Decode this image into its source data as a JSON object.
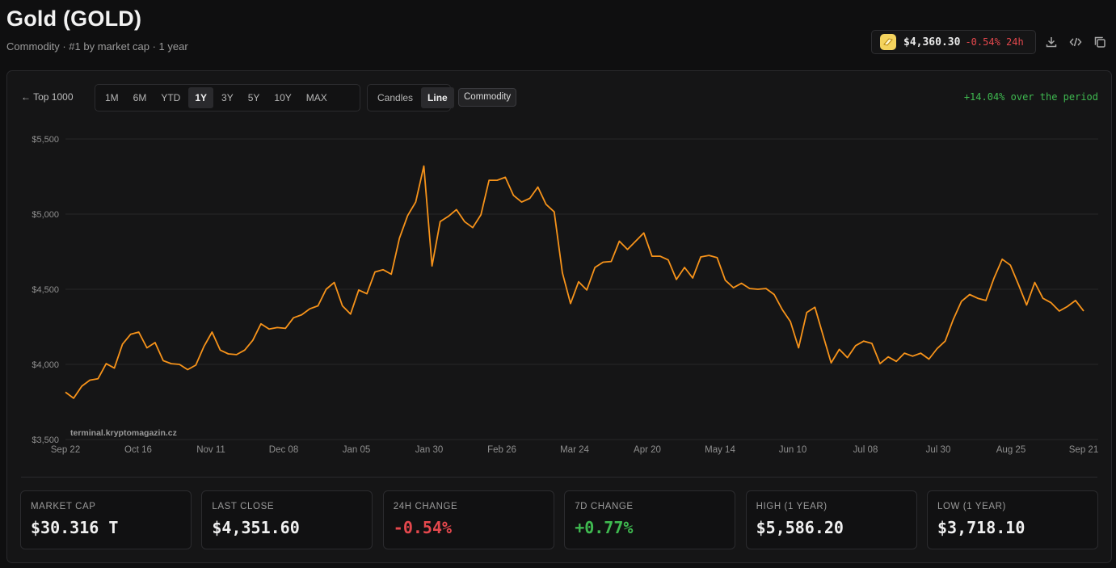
{
  "header": {
    "title": "Gold (GOLD)",
    "subtitle": "Commodity · #1 by market cap · 1 year"
  },
  "price_pill": {
    "price": "$4,360.30",
    "change": "-0.54% 24h",
    "change_color": "#e5484d"
  },
  "header_icons": [
    "download-icon",
    "code-icon",
    "copy-icon"
  ],
  "toolbar": {
    "back_label": "← Top 1000",
    "ranges": [
      {
        "label": "1M",
        "active": false
      },
      {
        "label": "6M",
        "active": false
      },
      {
        "label": "YTD",
        "active": false
      },
      {
        "label": "1Y",
        "active": true
      },
      {
        "label": "3Y",
        "active": false
      },
      {
        "label": "5Y",
        "active": false
      },
      {
        "label": "10Y",
        "active": false
      },
      {
        "label": "MAX",
        "active": false
      }
    ],
    "chart_types": [
      {
        "label": "Candles",
        "active": false
      },
      {
        "label": "Line",
        "active": true
      }
    ],
    "tag_label": "Commodity",
    "period_change": "+14.04% over the period",
    "period_change_color": "#3fb950"
  },
  "chart_data": {
    "type": "line",
    "title": "",
    "xlabel": "",
    "ylabel": "",
    "ylim": [
      3500,
      5500
    ],
    "y_ticks": [
      "$5,500",
      "$5,000",
      "$4,500",
      "$4,000",
      "$3,500"
    ],
    "y_tick_values": [
      5500,
      5000,
      4500,
      4000,
      3500
    ],
    "x_ticks": [
      "Sep 22",
      "Oct 16",
      "Nov 11",
      "Dec 08",
      "Jan 05",
      "Jan 30",
      "Feb 26",
      "Mar 24",
      "Apr 20",
      "May 14",
      "Jun 10",
      "Jul 08",
      "Jul 30",
      "Aug 25",
      "Sep 21"
    ],
    "grid": true,
    "line_color": "#f7931a",
    "watermark": "terminal.kryptomagazin.cz",
    "series": [
      {
        "values": [
          3815,
          3775,
          3855,
          3895,
          3905,
          4005,
          3975,
          4135,
          4200,
          4215,
          4110,
          4145,
          4025,
          4005,
          4000,
          3965,
          3995,
          4120,
          4215,
          4095,
          4070,
          4065,
          4095,
          4160,
          4270,
          4235,
          4245,
          4240,
          4310,
          4330,
          4370,
          4390,
          4500,
          4545,
          4390,
          4335,
          4495,
          4470,
          4615,
          4630,
          4600,
          4840,
          4990,
          5080,
          5320,
          4655,
          4950,
          4985,
          5030,
          4950,
          4910,
          4995,
          5225,
          5225,
          5245,
          5125,
          5080,
          5105,
          5180,
          5065,
          5015,
          4610,
          4405,
          4550,
          4495,
          4645,
          4680,
          4685,
          4820,
          4765,
          4820,
          4875,
          4720,
          4720,
          4695,
          4565,
          4645,
          4575,
          4715,
          4725,
          4710,
          4560,
          4510,
          4540,
          4505,
          4500,
          4505,
          4465,
          4365,
          4285,
          4110,
          4345,
          4380,
          4195,
          4010,
          4100,
          4045,
          4125,
          4155,
          4140,
          4005,
          4050,
          4020,
          4075,
          4055,
          4075,
          4035,
          4105,
          4155,
          4300,
          4420,
          4465,
          4440,
          4425,
          4575,
          4700,
          4660,
          4530,
          4395,
          4545,
          4440,
          4410,
          4355,
          4385,
          4425,
          4355
        ]
      }
    ]
  },
  "stats": [
    {
      "label": "MARKET CAP",
      "value": "$30.316 T",
      "tone": "neutral"
    },
    {
      "label": "LAST CLOSE",
      "value": "$4,351.60",
      "tone": "neutral"
    },
    {
      "label": "24H CHANGE",
      "value": "-0.54%",
      "tone": "neg"
    },
    {
      "label": "7D CHANGE",
      "value": "+0.77%",
      "tone": "pos"
    },
    {
      "label": "HIGH (1 YEAR)",
      "value": "$5,586.20",
      "tone": "neutral"
    },
    {
      "label": "LOW (1 YEAR)",
      "value": "$3,718.10",
      "tone": "neutral"
    }
  ]
}
